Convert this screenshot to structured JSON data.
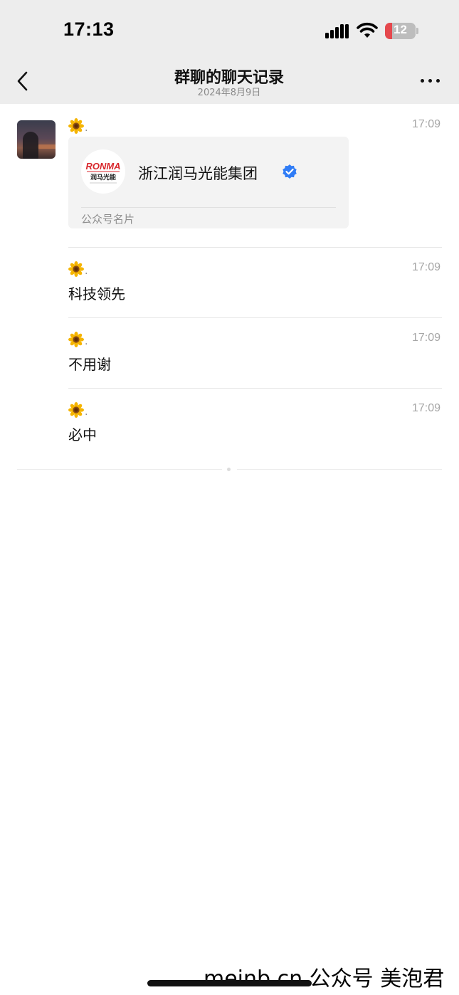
{
  "status_bar": {
    "time": "17:13",
    "battery_level": "12",
    "battery_fraction": 0.12
  },
  "nav": {
    "title": "群聊的聊天记录",
    "subtitle": "2024年8月9日",
    "back_icon": "chevron-left-icon",
    "more_icon": "more-dots-icon"
  },
  "sender": {
    "name_suffix": ".",
    "avatar_icon": "sunflower-icon"
  },
  "messages": [
    {
      "time": "17:09",
      "type": "card",
      "card": {
        "logo_text": "RONMA",
        "logo_subtitle": "润马光能",
        "name": "浙江润马光能集团",
        "verified_icon": "verified-badge-icon",
        "type_label": "公众号名片"
      }
    },
    {
      "time": "17:09",
      "type": "text",
      "text": "科技领先"
    },
    {
      "time": "17:09",
      "type": "text",
      "text": "不用谢"
    },
    {
      "time": "17:09",
      "type": "text",
      "text": "必中"
    }
  ],
  "watermark": "meinb.cn 公众号 美泡君",
  "colors": {
    "topbar_bg": "#ededed",
    "verified_blue": "#2f7cf6",
    "battery_red": "#e5484d",
    "logo_red": "#d8262b"
  }
}
